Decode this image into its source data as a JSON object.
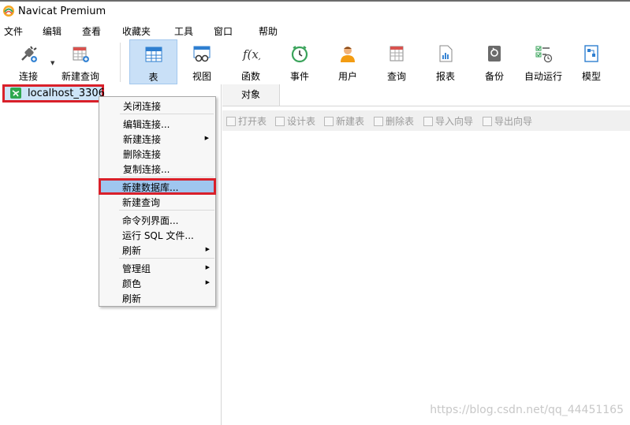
{
  "window": {
    "title": "Navicat Premium"
  },
  "menu": [
    "文件",
    "编辑",
    "查看",
    "收藏夹",
    "工具",
    "窗口",
    "帮助"
  ],
  "toolbar": [
    {
      "label": "连接",
      "icon": "connection-plug-icon"
    },
    {
      "label": "新建查询",
      "icon": "new-query-icon"
    },
    {
      "label": "表",
      "icon": "table-icon",
      "active": true
    },
    {
      "label": "视图",
      "icon": "view-icon"
    },
    {
      "label": "函数",
      "icon": "function-icon"
    },
    {
      "label": "事件",
      "icon": "event-clock-icon"
    },
    {
      "label": "用户",
      "icon": "user-icon"
    },
    {
      "label": "查询",
      "icon": "query-icon"
    },
    {
      "label": "报表",
      "icon": "report-icon"
    },
    {
      "label": "备份",
      "icon": "backup-icon"
    },
    {
      "label": "自动运行",
      "icon": "automation-icon"
    },
    {
      "label": "模型",
      "icon": "model-icon"
    }
  ],
  "tree": {
    "connection": "localhost_3306"
  },
  "tabs": {
    "objects": "对象"
  },
  "object_toolbar": [
    "打开表",
    "设计表",
    "新建表",
    "删除表",
    "导入向导",
    "导出向导"
  ],
  "context_menu": [
    {
      "label": "关闭连接"
    },
    {
      "label": "编辑连接..."
    },
    {
      "label": "新建连接",
      "submenu": true
    },
    {
      "label": "删除连接"
    },
    {
      "label": "复制连接..."
    },
    {
      "label": "新建数据库...",
      "highlighted": true
    },
    {
      "label": "新建查询"
    },
    {
      "label": "命令列界面..."
    },
    {
      "label": "运行 SQL 文件..."
    },
    {
      "label": "刷新",
      "submenu": true
    },
    {
      "label": "管理组",
      "submenu": true
    },
    {
      "label": "颜色",
      "submenu": true
    },
    {
      "label": "刷新"
    }
  ],
  "colors": {
    "accent": "#c9e0f7",
    "highlight_box": "#d9202a",
    "menu_highlight": "#9fc6ef"
  },
  "watermark": "https://blog.csdn.net/qq_44451165"
}
